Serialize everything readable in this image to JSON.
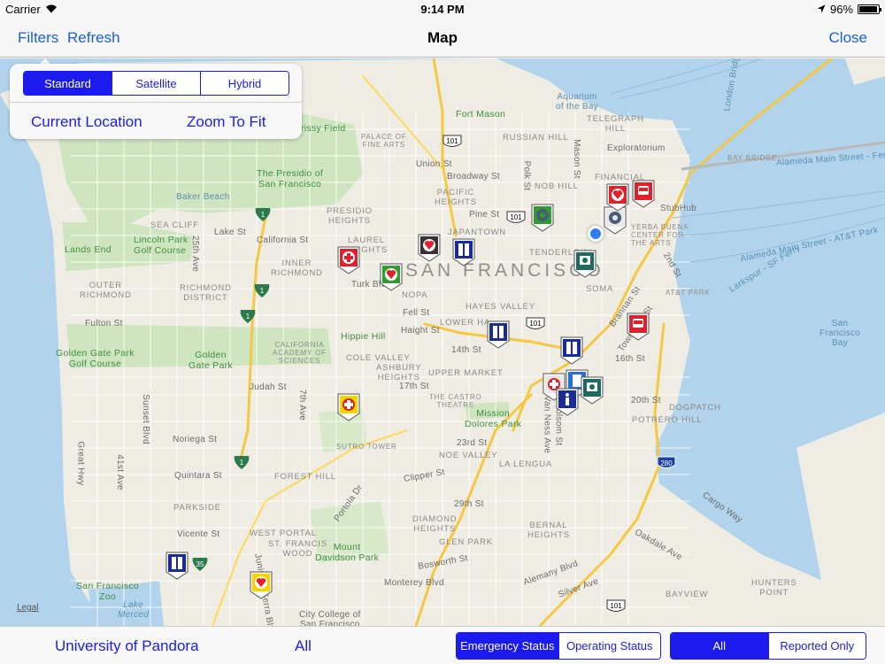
{
  "status_bar": {
    "carrier": "Carrier",
    "time": "9:14 PM",
    "battery": "96%"
  },
  "nav": {
    "filters": "Filters",
    "refresh": "Refresh",
    "title": "Map",
    "close": "Close"
  },
  "popover": {
    "map_types": [
      "Standard",
      "Satellite",
      "Hybrid"
    ],
    "selected_map_type": "Standard",
    "current_location": "Current Location",
    "zoom_to_fit": "Zoom To Fit"
  },
  "bottom": {
    "campus": "University of Pandora",
    "filter": "All",
    "status_options": [
      "Emergency Status",
      "Operating Status"
    ],
    "selected_status": "Emergency Status",
    "report_options": [
      "All",
      "Reported Only"
    ],
    "selected_report": "All"
  },
  "map": {
    "legal": "Legal",
    "labels": {
      "city": "SAN FRANCISCO",
      "fort_mason": "Fort Mason",
      "aquarium": "Aquarium\nof the Bay",
      "telegraph": "TELEGRAPH\nHILL",
      "palace": "PALACE OF\nFINE ARTS",
      "russian_hill": "RUSSIAN HILL",
      "exploratorium": "Exploratorium",
      "union_st": "Union St",
      "broadway": "Broadway St",
      "crissy": "rissy Field",
      "presidio": "The Presidio of\nSan Francisco",
      "baker": "Baker Beach",
      "sea_cliff": "SEA CLIFF",
      "presidio_heights": "PRESIDIO\nHEIGHTS",
      "pacific_heights": "PACIFIC\nHEIGHTS",
      "nob_hill": "NOB HILL",
      "financial": "FINANCIAL",
      "pine": "Pine St",
      "polk": "Polk St",
      "mason": "Mason St",
      "stubhub": "StubHub",
      "bay_bridge": "BAY BRIDGE",
      "alameda": "Alameda Main Street - Ferry",
      "lincoln": "Lincoln Park\nGolf Course",
      "lands_end": "Lands End",
      "lake": "Lake St",
      "california": "California St",
      "laurel": "LAUREL\nHEIGHTS",
      "japantown": "JAPANTOWN",
      "tenderloin": "TENDERLOIN",
      "yerba": "YERBA BUENA\nCENTER FOR\nTHE ARTS",
      "ave25": "25th Ave",
      "outer_richmond": "OUTER\nRICHMOND",
      "richmond": "RICHMOND\nDISTRICT",
      "inner_richmond": "INNER\nRICHMOND",
      "turk": "Turk Blvd",
      "nopa": "NOPA",
      "soma": "SOMA",
      "second": "2nd St",
      "att": "AT&T PARK",
      "fulton": "Fulton St",
      "fell": "Fell St",
      "hayes": "HAYES VALLEY",
      "lower_haight": "LOWER HA",
      "haight": "Haight St",
      "hippie": "Hippie Hill",
      "cal_academy": "CALIFORNIA\nACADEMY OF\nSCIENCES",
      "ggpark_golf": "Golden Gate Park\nGolf Course",
      "ggpark": "Golden\nGate Park",
      "cole": "COLE VALLEY",
      "ashbury": "ASHBURY\nHEIGHTS",
      "st14": "14th St",
      "upper_market": "UPPER MARKET",
      "st16": "16th St",
      "sf_bay": "San\nFrancisco\nBay",
      "judah": "Judah St",
      "st17": "17th St",
      "castro": "THE CASTRO\nTHEATRE",
      "mission_dolores": "Mission\nDolores Park",
      "st20": "20th St",
      "potrero": "POTRERO HILL",
      "dogpatch": "DOGPATCH",
      "sunset": "Sunset Blvd",
      "ave7": "7th Ave",
      "noriega": "Noriega St",
      "sutro": "SUTRO TOWER",
      "st23": "23rd St",
      "noe": "NOE VALLEY",
      "la_lengua": "LA LENGUA",
      "van_ness": "S Van Ness Ave",
      "folsom": "Folsom St",
      "great_hwy": "Great Hwy",
      "ave41": "41st Ave",
      "quintara": "Quintara St",
      "forest_hill": "FOREST HILL",
      "clipper": "Clipper St",
      "portola": "Portola Dr",
      "st29": "29th St",
      "diamond": "DIAMOND\nHEIGHTS",
      "bernal": "BERNAL\nHEIGHTS",
      "parkside": "PARKSIDE",
      "cargo": "Cargo Way",
      "vicente": "Vicente St",
      "west_portal": "WEST PORTAL",
      "st_francis": "ST. FRANCIS\nWOOD",
      "glen_park": "GLEN PARK",
      "mount_davidson": "Mount\nDavidson Park",
      "bosworth": "Bosworth St",
      "alemany": "Alemany Blvd",
      "oakdale": "Oakdale Ave",
      "sf_zoo": "San Francisco\nZoo",
      "lake_merced": "Lake\nMerced",
      "monterey": "Monterey Blvd",
      "silver": "Silver Ave",
      "hunters": "HUNTERS\nPOINT",
      "bayview": "BAYVIEW",
      "city_college": "City College of\nSan Francisco",
      "junipero": "Junipero Serra Blvd",
      "brannan": "Brannan St",
      "townsend": "Townsend St",
      "larkspur": "Larkspur - SF Ferry",
      "alameda_att": "Alameda Main Street - AT&T Park",
      "london": "London Bridge"
    },
    "shields": [
      "101",
      "101",
      "101",
      "280",
      "1",
      "1",
      "1",
      "1",
      "35",
      "101"
    ]
  },
  "colors": {
    "accent": "#1b1bf0",
    "nav_link": "#1560e8",
    "emergency_red": "#e0202a",
    "caution_yellow": "#f5d400",
    "ok_green": "#2f9e2f",
    "info_blue": "#1a2c9a",
    "teal": "#1b6b5e"
  }
}
